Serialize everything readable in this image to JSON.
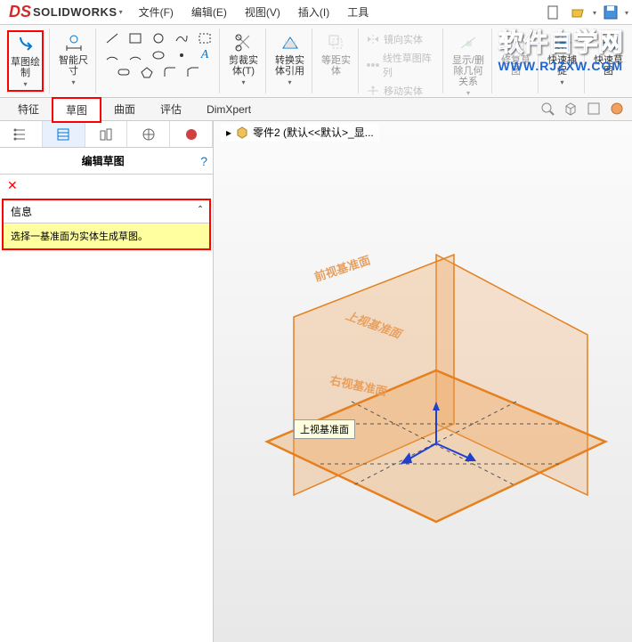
{
  "app": {
    "name": "SOLIDWORKS"
  },
  "menu": {
    "file": "文件(F)",
    "edit": "编辑(E)",
    "view": "视图(V)",
    "insert": "插入(I)",
    "tools": "工具"
  },
  "ribbon": {
    "sketch": "草图绘\n制",
    "smart_dim": "智能尺\n寸",
    "trim": "剪裁实\n体(T)",
    "convert": "转换实\n体引用",
    "offset": "等距实\n体",
    "mirror": "镜向实体",
    "linear_pattern": "线性草图阵列",
    "move": "移动实体",
    "relations": "显示/删\n除几何\n关系",
    "repair": "修复草\n图",
    "snap": "快速捕\n捉",
    "rapid": "快速草\n图"
  },
  "tabs": {
    "feature": "特征",
    "sketch": "草图",
    "surface": "曲面",
    "evaluate": "评估",
    "dimxpert": "DimXpert"
  },
  "side": {
    "title": "编辑草图",
    "info_header": "信息",
    "info_text": "选择一基准面为实体生成草图。"
  },
  "breadcrumb": {
    "part": "零件2 (默认<<默认>_显..."
  },
  "planes": {
    "front": "前视基准面",
    "top": "上视基准面",
    "right": "右视基准面",
    "tooltip": "上视基准面"
  },
  "watermark": {
    "title": "软件自学网",
    "url": "WWW.RJZXW.COM"
  }
}
